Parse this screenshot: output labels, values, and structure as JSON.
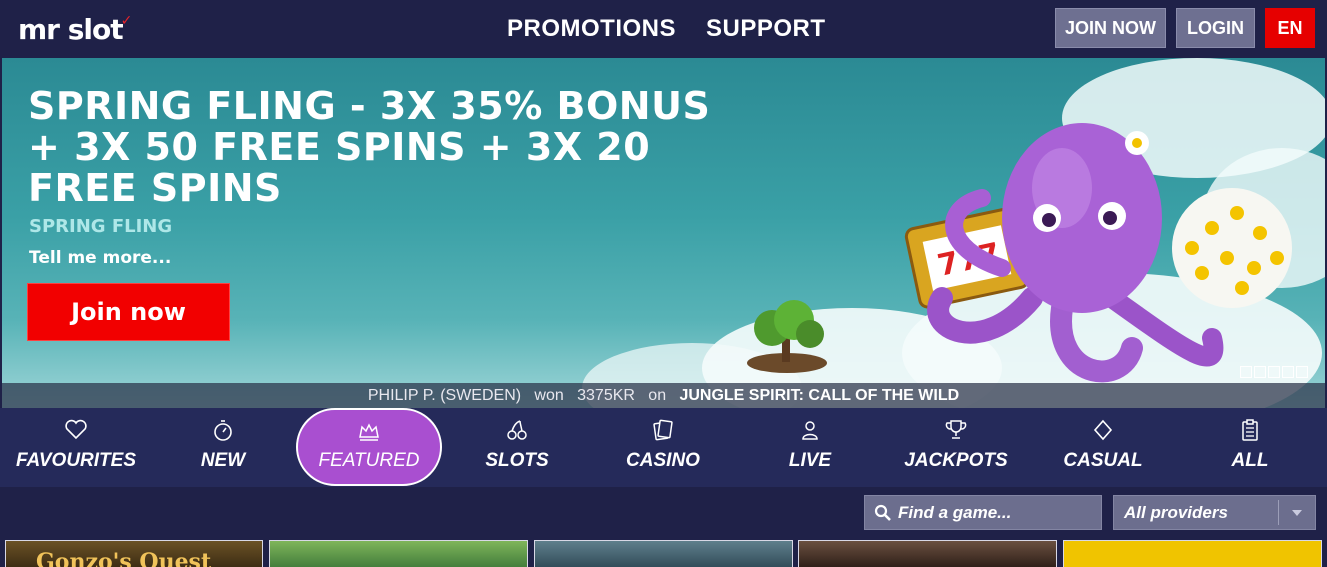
{
  "header": {
    "logo_text": "mr slot",
    "nav": [
      {
        "label": "PROMOTIONS"
      },
      {
        "label": "SUPPORT"
      }
    ],
    "join_label": "JOIN NOW",
    "login_label": "LOGIN",
    "language": "EN"
  },
  "hero": {
    "title": "SPRING FLING - 3X 35% BONUS + 3X 50 FREE SPINS + 3X 20 FREE SPINS",
    "subtitle": "SPRING FLING",
    "more_link": "Tell me more...",
    "cta_label": "Join now",
    "slide_count": 5,
    "active_slide": 1,
    "ticker": {
      "player": "PHILIP P. (SWEDEN)",
      "won_word": "won",
      "amount": "3375KR",
      "on_word": "on",
      "game": "JUNGLE SPIRIT: CALL OF THE WILD"
    }
  },
  "categories": [
    {
      "label": "FAVOURITES",
      "icon": "heart-icon"
    },
    {
      "label": "NEW",
      "icon": "stopwatch-icon"
    },
    {
      "label": "FEATURED",
      "icon": "crown-icon",
      "active": true
    },
    {
      "label": "SLOTS",
      "icon": "cherries-icon"
    },
    {
      "label": "CASINO",
      "icon": "playing-cards-icon"
    },
    {
      "label": "LIVE",
      "icon": "dealer-icon"
    },
    {
      "label": "JACKPOTS",
      "icon": "trophy-icon"
    },
    {
      "label": "CASUAL",
      "icon": "diamond-icon"
    },
    {
      "label": "ALL",
      "icon": "clipboard-icon"
    }
  ],
  "search": {
    "placeholder": "Find a game...",
    "providers_value": "All providers"
  },
  "game_tiles": [
    {
      "label": "Gonzo's Quest",
      "color": "#4a3a1f"
    },
    {
      "label": "",
      "color": "#3f7a3a"
    },
    {
      "label": "",
      "color": "#39586a"
    },
    {
      "label": "",
      "color": "#3b2a22"
    },
    {
      "label": "",
      "color": "#f0c400"
    }
  ],
  "colors": {
    "background": "#1f2148",
    "accent_red": "#f20000",
    "featured_purple": "#a94fd0",
    "hero_teal": "#3aa0a6"
  }
}
